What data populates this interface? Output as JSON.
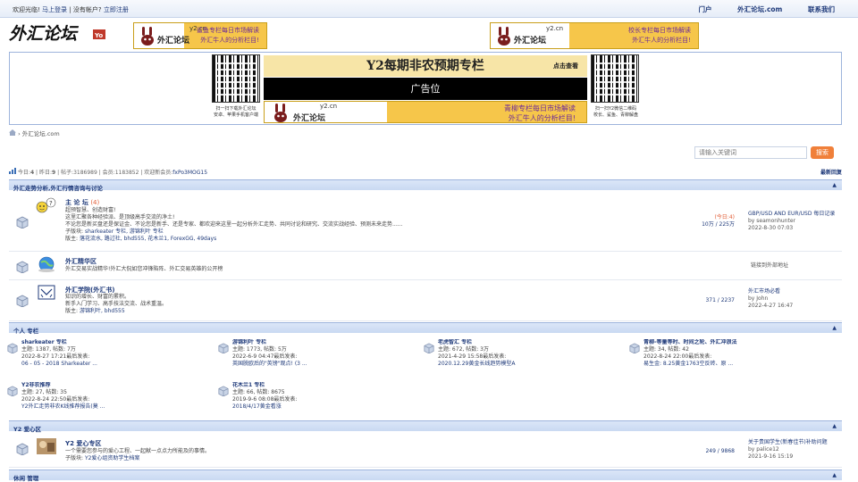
{
  "topbar": {
    "greeting": "欢迎光临!",
    "login": "马上登录",
    "separator": "|",
    "no_account": "没有帐户?",
    "register": "立即注册",
    "nav": [
      "门户",
      "外汇论坛.com",
      "联系我们"
    ]
  },
  "logo": {
    "text": "外汇论坛",
    "badge": "Yo"
  },
  "banner_left": {
    "site": "y2.cn",
    "line1": "鲨鱼专栏每日市场解读",
    "line2": "外汇牛人的分析栏目!",
    "logo_text": "外汇论坛"
  },
  "banner_right": {
    "site": "y2.cn",
    "line1": "校长专栏每日市场解读",
    "line2": "外汇牛人的分析栏目!",
    "logo_text": "外汇论坛"
  },
  "big_ad": {
    "headline": "Y2每期非农预期专栏",
    "click": "点击查看",
    "middle": "广告位",
    "bottom_site": "y2.cn",
    "bottom_line1": "青柳专栏每日市场解读",
    "bottom_line2": "外汇牛人的分析栏目!",
    "bottom_logo": "外汇论坛",
    "qr_left_note1": "扫一扫下载外汇论坛",
    "qr_left_note2": "安卓、苹果手机客户端",
    "qr_right_note1": "扫一扫Y2微信二维码",
    "qr_right_note2": "校长、鲨鱼、青柳解盘"
  },
  "breadcrumb": {
    "separator": "›",
    "item": "外汇论坛.com"
  },
  "search": {
    "placeholder": "请输入关键词",
    "button": "搜索"
  },
  "stats": {
    "today_label": "今日:",
    "today": "4",
    "yesterday_label": "昨日:",
    "yesterday": "9",
    "posts_label": "帖子:",
    "posts": "3186989",
    "members_label": "会员:",
    "members": "1183852",
    "welcome_label": "欢迎新会员:",
    "newest": "fxPo3MOG15",
    "latest_link": "最新回复"
  },
  "categories": [
    {
      "title": "外汇走势分析,外汇行情咨询与讨论",
      "forums": [
        {
          "name": "主 论 坛",
          "today": "(4)",
          "desc1": "超预智慧、创造财富!",
          "desc2": "这里汇聚各种经验派、是顶级高手交流的净土!",
          "desc3": "不论您是新买盘还是保证金、不论您是新手、还是专家、都欢迎来这里一起分析外汇走势、共同讨论和研究、交流实战经验、预测未来走势......",
          "sub_label": "子版块:",
          "subs": "sharkeater 专栏, 游锦利叶 专栏",
          "mod_label": "版主:",
          "mods": "落花流水, 路过社, bhd555, 花木兰1, ForexGG, 49days",
          "stat_today": "(今日:4)",
          "stat": "10万 / 225万",
          "last_title": "GBP/USD AND EUR/USD 每日记录",
          "last_by": "by seamonhunter",
          "last_time": "2022-8-30 07:03"
        },
        {
          "name": "外汇精华区",
          "desc1": "外汇交易实战精华!外汇大侃如您冲锋陷阵、外汇交易英雄的公开榜",
          "link_out": "链接到外部地址"
        },
        {
          "name": "外汇学院(外汇书)",
          "desc1": "知识的增长、财富的累积。",
          "desc2": "新手入门学习、高手技法交流、战术重温。",
          "mod_label": "版主:",
          "mods": "游锦利叶, bhd555",
          "stat": "371 / 2237",
          "last_title": "外汇市场必看",
          "last_by": "by John",
          "last_time": "2022-4-27 16:47"
        }
      ]
    },
    {
      "title": "个人 专栏",
      "cells": [
        {
          "name": "sharkeater 专栏",
          "line1": "主题: 1387, 帖数: 7万",
          "line2": "2022-8-27 17:21最后发表:",
          "line3": "06 - 05 - 2018 Sharkeater ..."
        },
        {
          "name": "游锦利叶 专栏",
          "line1": "主题: 1773, 帖数: 5万",
          "line2": "2022-6-9 04:47最后发表:",
          "line3": "英国脱欧后的\"英镑\"观点! (3 ..."
        },
        {
          "name": "老虎智汇 专栏",
          "line1": "主题: 672, 帖数: 3万",
          "line2": "2021-4-29 15:58最后发表:",
          "line3": "2020.12.29黄金长线趋势模型A"
        },
        {
          "name": "青柳-等量等时、时间之轮、外汇冲浪法",
          "line1": "主题: 34, 帖数: 42",
          "line2": "2022-8-24 22:00最后发表:",
          "line3": "易生金: 8.25黄金1763空反砖、原 ..."
        },
        {
          "name": "Y2非农推荐",
          "line1": "主题: 27, 帖数: 35",
          "line2": "2022-8-24 22:50最后发表:",
          "line3": "Y2外汇走势非农K线推荐报告(莫 ..."
        },
        {
          "name": "花木兰1 专栏",
          "line1": "主题: 66, 帖数: 8675",
          "line2": "2019-9-6 08:08最后发表:",
          "line3": "2018/4/17黄金看涨"
        }
      ]
    },
    {
      "title": "Y2 爱心区",
      "forums": [
        {
          "name": "Y2 爱心专区",
          "desc1": "一个需要您参与的爱心工程、一起献一点点力所能及的事情。",
          "sub_label": "子版块:",
          "subs": "Y2爱心组资助学生档案",
          "stat": "249 / 9868",
          "last_title": "关于贵国学生(新春佳节)补助问题",
          "last_by": "by palice12",
          "last_time": "2021-9-16 15:19"
        }
      ]
    },
    {
      "title": "休闲 管理"
    }
  ],
  "colors": {
    "accent": "#1f3a7a",
    "header_bg": "#c9d9f2",
    "search_btn": "#f0803a",
    "ad_gold": "#f6c64a"
  }
}
